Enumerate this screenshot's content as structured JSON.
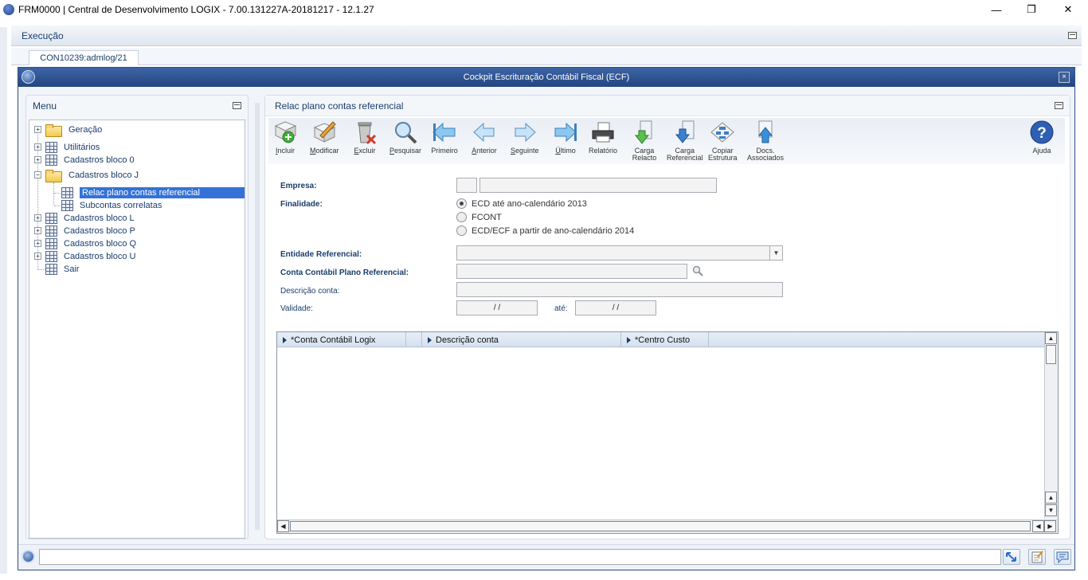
{
  "titlebar": {
    "title": "FRM0000 | Central de Desenvolvimento LOGIX  -  7.00.131227A-20181217  -  12.1.27",
    "minimize": "—",
    "restore": "❐",
    "close": "✕"
  },
  "execution_bar": {
    "label": "Execução"
  },
  "tab": {
    "label": "CON10239:admlog/21"
  },
  "window": {
    "title": "Cockpit Escrituração Contábil Fiscal (ECF)",
    "close": "×"
  },
  "menu": {
    "header": "Menu",
    "items": [
      {
        "label": "Geração",
        "kind": "folder",
        "expander": "+"
      },
      {
        "label": "Utilitários",
        "kind": "grid",
        "expander": "+"
      },
      {
        "label": "Cadastros bloco 0",
        "kind": "grid",
        "expander": "+"
      },
      {
        "label": "Cadastros bloco J",
        "kind": "folder",
        "expander": "−"
      },
      {
        "label": "Relac plano contas referencial",
        "kind": "grid",
        "selected": true
      },
      {
        "label": "Subcontas correlatas",
        "kind": "grid"
      },
      {
        "label": "Cadastros bloco L",
        "kind": "grid",
        "expander": "+"
      },
      {
        "label": "Cadastros bloco P",
        "kind": "grid",
        "expander": "+"
      },
      {
        "label": "Cadastros bloco Q",
        "kind": "grid",
        "expander": "+"
      },
      {
        "label": "Cadastros bloco U",
        "kind": "grid",
        "expander": "+"
      },
      {
        "label": "Sair",
        "kind": "grid"
      }
    ]
  },
  "content": {
    "header": "Relac plano contas referencial",
    "toolbar": {
      "incluir": "Incluir",
      "modificar": "Modificar",
      "excluir": "Excluir",
      "pesquisar": "Pesquisar",
      "primeiro": "Primeiro",
      "anterior": "Anterior",
      "seguinte": "Seguinte",
      "ultimo": "Último",
      "relatorio": "Relatório",
      "carga_relacto_1": "Carga",
      "carga_relacto_2": "Relacto",
      "carga_referencial_1": "Carga",
      "carga_referencial_2": "Referencial",
      "copiar_estrutura_1": "Copiar",
      "copiar_estrutura_2": "Estrutura",
      "docs_associados_1": "Docs.",
      "docs_associados_2": "Associados",
      "ajuda": "Ajuda"
    },
    "form": {
      "empresa_label": "Empresa:",
      "empresa_code": "",
      "empresa_name": "",
      "finalidade_label": "Finalidade:",
      "finalidade_options": [
        {
          "label": "ECD até ano-calendário 2013",
          "selected": true
        },
        {
          "label": "FCONT",
          "selected": false
        },
        {
          "label": "ECD/ECF a partir de ano-calendário 2014",
          "selected": false
        }
      ],
      "entidade_label": "Entidade Referencial:",
      "entidade_value": "",
      "conta_label": "Conta Contábil Plano Referencial:",
      "conta_value": "",
      "descricao_label": "Descrição conta:",
      "descricao_value": "",
      "validade_label": "Validade:",
      "validade_from": " / /",
      "ate_label": "até:",
      "validade_to": " / /"
    },
    "grid": {
      "columns": [
        "*Conta Contábil Logix",
        "Descrição conta",
        "*Centro Custo"
      ],
      "rows": []
    }
  },
  "colors": {
    "window_title": "#2d4e86",
    "selection": "#3472d8",
    "label": "#1a3d6e"
  }
}
